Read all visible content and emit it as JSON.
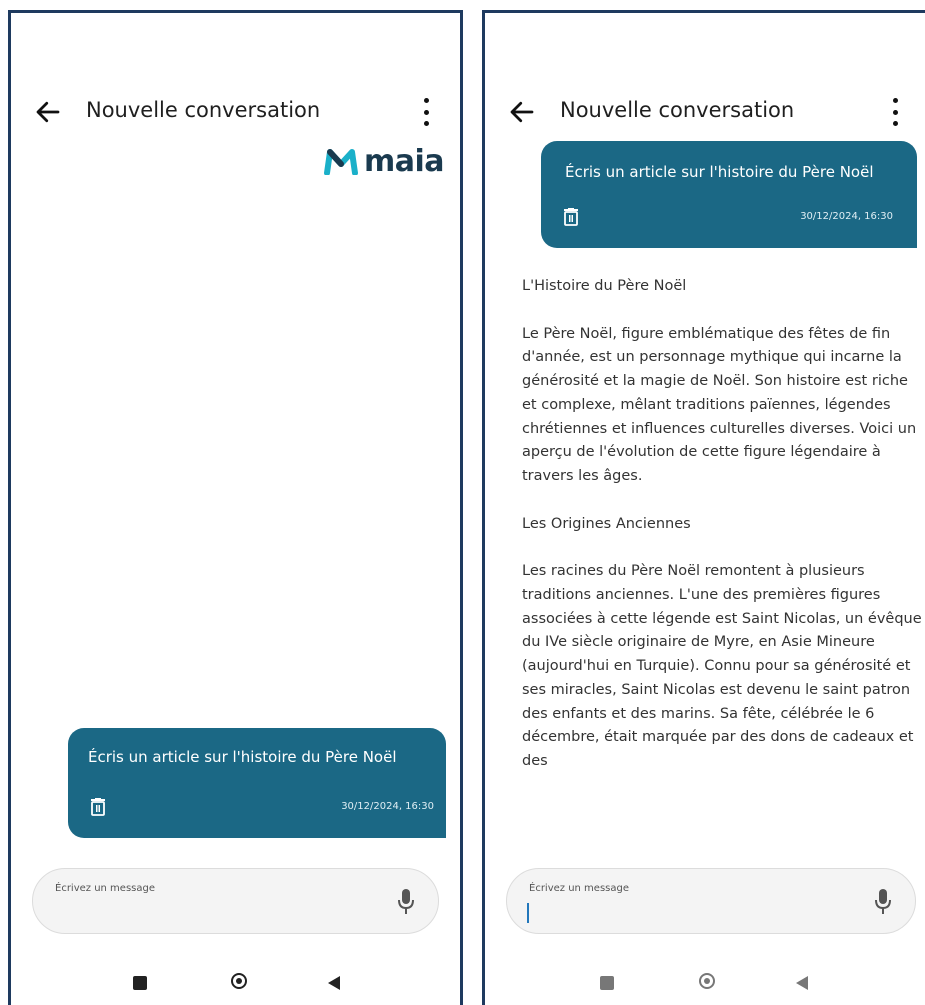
{
  "colors": {
    "accent": "#1b6885",
    "logo_mark": "#1ab0c9",
    "logo_text": "#1a3a4f"
  },
  "left_screen": {
    "header": {
      "title": "Nouvelle conversation",
      "back_icon": "arrow-left-icon",
      "menu_icon": "more-vertical-icon"
    },
    "logo": {
      "text": "maia",
      "mark": "M"
    },
    "message": {
      "text": "Écris un article sur l'histoire du Père Noël",
      "timestamp": "30/12/2024, 16:30",
      "delete_icon": "trash-icon"
    },
    "composer": {
      "placeholder": "Écrivez un message",
      "mic_icon": "microphone-icon"
    }
  },
  "right_screen": {
    "header": {
      "title": "Nouvelle conversation",
      "back_icon": "arrow-left-icon",
      "menu_icon": "more-vertical-icon"
    },
    "message": {
      "text": "Écris un article sur l'histoire du Père Noël",
      "timestamp": "30/12/2024, 16:30",
      "delete_icon": "trash-icon"
    },
    "article": {
      "title": "L'Histoire du Père Noël",
      "intro": "Le Père Noël, figure emblématique des fêtes de fin d'année, est un personnage mythique qui incarne la générosité et la magie de Noël. Son histoire est riche et complexe, mêlant traditions païennes, légendes chrétiennes et influences culturelles diverses. Voici un aperçu de l'évolution de cette figure légendaire à travers les âges.",
      "section_heading": "Les Origines Anciennes",
      "section_text": "Les racines du Père Noël remontent à plusieurs traditions anciennes. L'une des premières figures associées à cette légende est Saint Nicolas, un évêque du IVe siècle originaire de Myre, en Asie Mineure (aujourd'hui en Turquie). Connu pour sa générosité et ses miracles, Saint Nicolas est devenu le saint patron des enfants et des marins. Sa fête, célébrée le 6 décembre, était marquée par des dons de cadeaux et des"
    },
    "composer": {
      "placeholder": "Écrivez un message",
      "mic_icon": "microphone-icon"
    }
  },
  "nav_bar": {
    "icons": [
      "recents-square-icon",
      "home-circle-icon",
      "back-triangle-icon"
    ]
  }
}
